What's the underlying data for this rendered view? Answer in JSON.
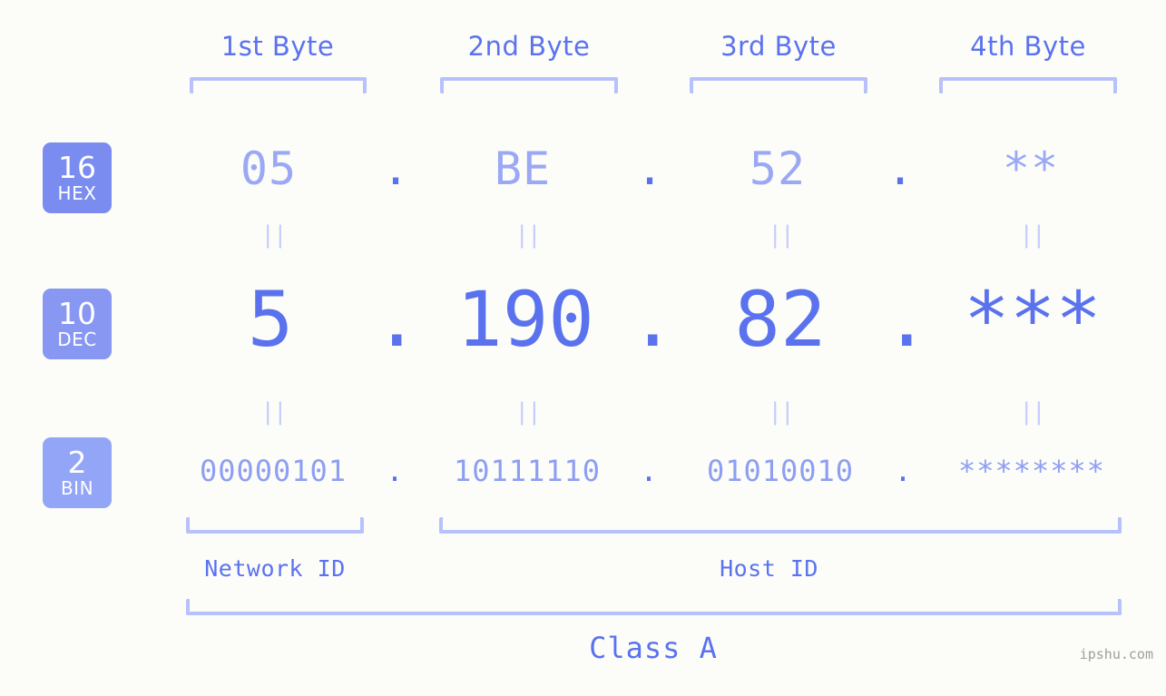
{
  "background_color": "#fcfdf9",
  "accent_color": "#5b72ef",
  "accent_light": "#9aa8f5",
  "bracket_color": "#b7c1fb",
  "header": {
    "byte_labels": [
      {
        "label": "1st Byte"
      },
      {
        "label": "2nd Byte"
      },
      {
        "label": "3rd Byte"
      },
      {
        "label": "4th Byte"
      }
    ]
  },
  "rows": [
    {
      "id": "hex",
      "badge": {
        "number": "16",
        "name": "HEX",
        "color": "#7a8cf0"
      },
      "separator": ".",
      "cells": [
        "05",
        "BE",
        "52",
        "**"
      ]
    },
    {
      "id": "dec",
      "badge": {
        "number": "10",
        "name": "DEC",
        "color": "#8897f2"
      },
      "separator": ".",
      "cells": [
        "5",
        "190",
        "82",
        "***"
      ]
    },
    {
      "id": "bin",
      "badge": {
        "number": "2",
        "name": "BIN",
        "color": "#93a5f6"
      },
      "separator": ".",
      "cells": [
        "00000101",
        "10111110",
        "01010010",
        "********"
      ]
    }
  ],
  "equals_marker": "||",
  "footer": {
    "network_id_label": "Network ID",
    "host_id_label": "Host ID",
    "class_label": "Class A",
    "watermark": "ipshu.com"
  }
}
